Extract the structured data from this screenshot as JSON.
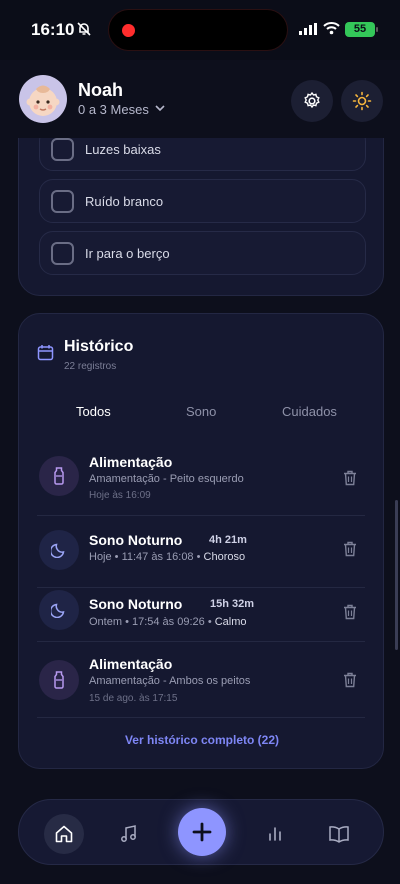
{
  "status_bar": {
    "time": "16:10",
    "battery": "55"
  },
  "header": {
    "name": "Noah",
    "age_range": "0 a 3 Meses",
    "icons": [
      "baby-avatar",
      "settings-icon",
      "sun-icon"
    ]
  },
  "checklist": {
    "items": [
      {
        "label": "Luzes baixas"
      },
      {
        "label": "Ruído branco"
      },
      {
        "label": "Ir para o berço"
      }
    ]
  },
  "history": {
    "title": "Histórico",
    "count": "22 registros",
    "tabs": [
      {
        "label": "Todos"
      },
      {
        "label": "Sono"
      },
      {
        "label": "Cuidados"
      }
    ],
    "entries": [
      {
        "type": "feeding",
        "title": "Alimentação",
        "detail": "Amamentação - Peito esquerdo",
        "time": "Hoje às 16:09"
      },
      {
        "type": "sleep",
        "title": "Sono Noturno",
        "duration": "4h 21m",
        "line": "Hoje • 11:47 às 16:08 •",
        "mood": "Choroso"
      },
      {
        "type": "sleep",
        "title": "Sono Noturno",
        "duration": "15h 32m",
        "line": "Ontem • 17:54 às 09:26 •",
        "mood": "Calmo"
      },
      {
        "type": "feeding",
        "title": "Alimentação",
        "detail": "Amamentação - Ambos os peitos",
        "time": "15 de ago. às 17:15"
      }
    ],
    "view_all": "Ver histórico completo (22)"
  },
  "colors": {
    "accent": "#8e95ff",
    "link": "#7e86f5",
    "background": "#0d0f1c",
    "card": "#151830"
  },
  "nav": {
    "items": [
      "home-icon",
      "music-icon",
      "add-icon",
      "stats-icon",
      "book-icon"
    ]
  }
}
